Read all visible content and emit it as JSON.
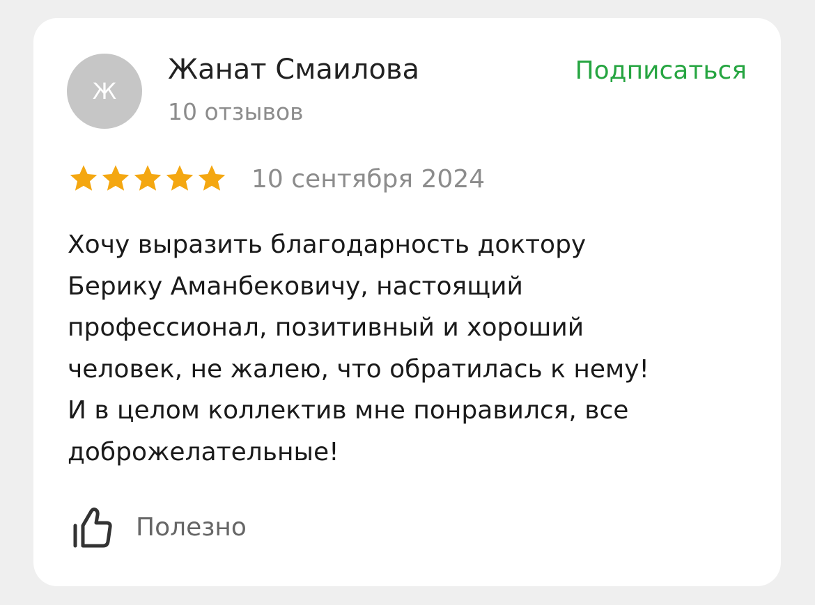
{
  "review": {
    "author": {
      "initial": "Ж",
      "name": "Жанат Смаилова",
      "reviews_count": "10 отзывов",
      "avatar_color": "#c6c6c6"
    },
    "subscribe_label": "Подписаться",
    "subscribe_color": "#26a541",
    "rating": 5,
    "rating_max": 5,
    "star_color": "#f4a711",
    "date": "10 сентября 2024",
    "text_lines": [
      "Хочу выразить благодарность доктору",
      "Берику Аманбековичу, настоящий",
      "профессионал, позитивный и хороший",
      "человек, не жалею, что обратилась к нему!",
      "И в целом коллектив мне понравился, все",
      "доброжелательные!"
    ],
    "helpful_icon": "thumbs-up-icon",
    "helpful_label": "Полезно"
  }
}
